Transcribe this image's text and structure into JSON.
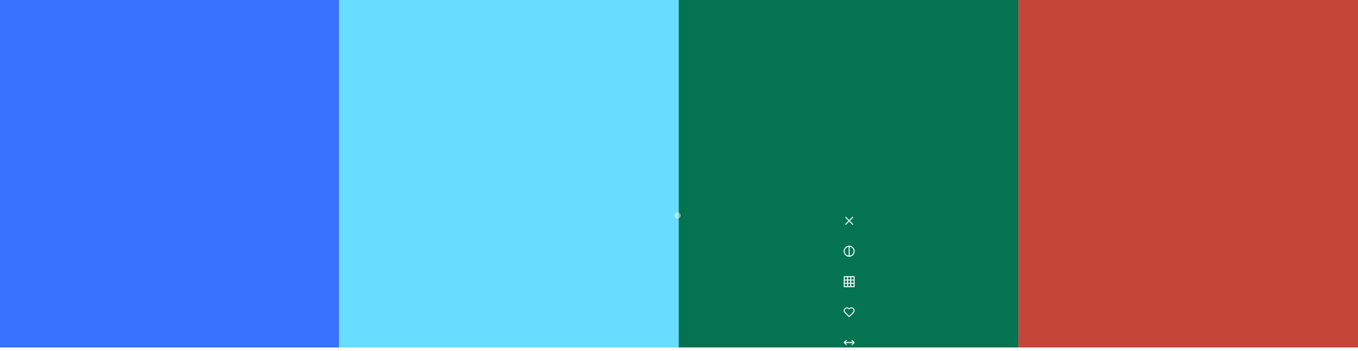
{
  "palette": {
    "swatches": [
      {
        "hex": "#3872FF"
      },
      {
        "hex": "#68DDFF"
      },
      {
        "hex": "#04734F"
      },
      {
        "hex": "#C44638"
      }
    ]
  },
  "toolbar": {
    "icons": [
      "close-icon",
      "contrast-icon",
      "grid-icon",
      "heart-icon",
      "expand-horizontal-icon"
    ],
    "icon_color": "#FFFFFF"
  }
}
